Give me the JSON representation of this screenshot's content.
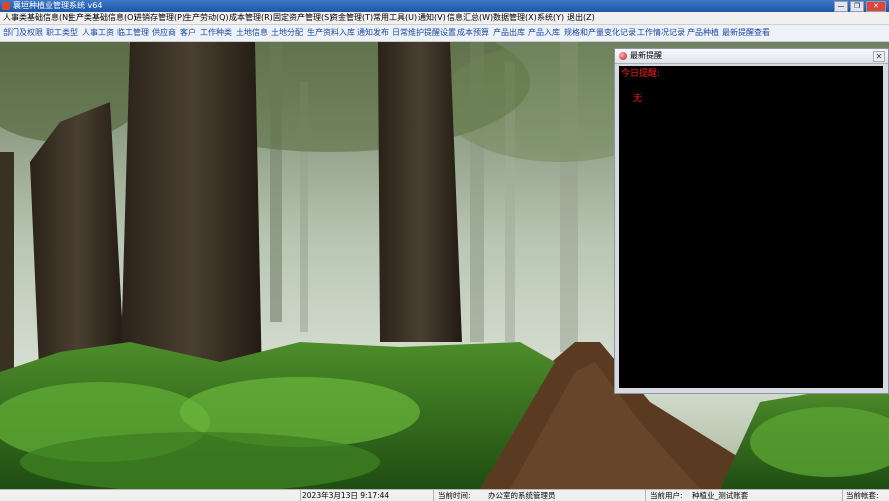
{
  "window": {
    "title": "襄垣种植业管理系统  v64",
    "minimize": "—",
    "restore": "❐",
    "close": "✕"
  },
  "menu": [
    "人事类基础信息(N)",
    "生产类基础信息(O)",
    "进销存管理(P)",
    "生产劳动(Q)",
    "成本管理(R)",
    "固定资产管理(S)",
    "资金管理(T)",
    "常用工具(U)",
    "通知(V)",
    "信息汇总(W)",
    "数据管理(X)",
    "系统(Y)",
    "退出(Z)"
  ],
  "toolbar": [
    "部门及权限",
    "职工类型",
    "人事工资",
    "临工管理",
    "供应商",
    "客户",
    "工作种类",
    "土地信息",
    "土地分配",
    "生产资料入库",
    "通知发布",
    "日常维护提醒设置",
    "成本预算",
    "产品出库",
    "产品入库",
    "规格和产量变化记录",
    "工作情况记录",
    "产品种植",
    "最新提醒查看"
  ],
  "reminder_panel": {
    "title": "最新提醒",
    "close": "✕",
    "heading": "今日提醒:",
    "content": "无",
    "text_color": "#ff2020"
  },
  "status": {
    "datetime": "2023年3月13日 9:17:44",
    "time_label": "当前时间:",
    "office": "办公室的系统管理员",
    "user_label": "当前用户:",
    "account": "种植业_测试账套",
    "account_label": "当前帐套:"
  }
}
